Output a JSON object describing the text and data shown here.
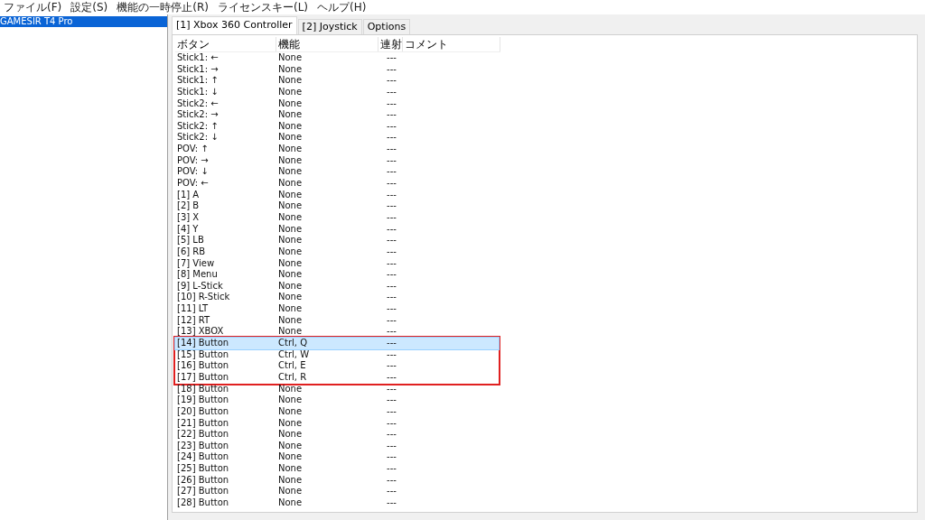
{
  "menu": [
    "ファイル(F)",
    "設定(S)",
    "機能の一時停止(R)",
    "ライセンスキー(L)",
    "ヘルプ(H)"
  ],
  "devices": [
    {
      "label": "GAMESIR T4 Pro",
      "selected": true
    }
  ],
  "tabs": [
    {
      "label": "[1] Xbox 360 Controller",
      "selected": true
    },
    {
      "label": "[2] Joystick",
      "selected": false
    },
    {
      "label": "Options",
      "selected": false
    }
  ],
  "table": {
    "columns": [
      "ボタン",
      "機能",
      "連射",
      "コメント"
    ],
    "rows": [
      {
        "button": "Stick1: ←",
        "function": "None",
        "rapid": "---",
        "selected": false,
        "highlighted": false
      },
      {
        "button": "Stick1: →",
        "function": "None",
        "rapid": "---",
        "selected": false,
        "highlighted": false
      },
      {
        "button": "Stick1: ↑",
        "function": "None",
        "rapid": "---",
        "selected": false,
        "highlighted": false
      },
      {
        "button": "Stick1: ↓",
        "function": "None",
        "rapid": "---",
        "selected": false,
        "highlighted": false
      },
      {
        "button": "Stick2: ←",
        "function": "None",
        "rapid": "---",
        "selected": false,
        "highlighted": false
      },
      {
        "button": "Stick2: →",
        "function": "None",
        "rapid": "---",
        "selected": false,
        "highlighted": false
      },
      {
        "button": "Stick2: ↑",
        "function": "None",
        "rapid": "---",
        "selected": false,
        "highlighted": false
      },
      {
        "button": "Stick2: ↓",
        "function": "None",
        "rapid": "---",
        "selected": false,
        "highlighted": false
      },
      {
        "button": "POV: ↑",
        "function": "None",
        "rapid": "---",
        "selected": false,
        "highlighted": false
      },
      {
        "button": "POV: →",
        "function": "None",
        "rapid": "---",
        "selected": false,
        "highlighted": false
      },
      {
        "button": "POV: ↓",
        "function": "None",
        "rapid": "---",
        "selected": false,
        "highlighted": false
      },
      {
        "button": "POV: ←",
        "function": "None",
        "rapid": "---",
        "selected": false,
        "highlighted": false
      },
      {
        "button": "[1] A",
        "function": "None",
        "rapid": "---",
        "selected": false,
        "highlighted": false
      },
      {
        "button": "[2] B",
        "function": "None",
        "rapid": "---",
        "selected": false,
        "highlighted": false
      },
      {
        "button": "[3] X",
        "function": "None",
        "rapid": "---",
        "selected": false,
        "highlighted": false
      },
      {
        "button": "[4] Y",
        "function": "None",
        "rapid": "---",
        "selected": false,
        "highlighted": false
      },
      {
        "button": "[5] LB",
        "function": "None",
        "rapid": "---",
        "selected": false,
        "highlighted": false
      },
      {
        "button": "[6] RB",
        "function": "None",
        "rapid": "---",
        "selected": false,
        "highlighted": false
      },
      {
        "button": "[7] View",
        "function": "None",
        "rapid": "---",
        "selected": false,
        "highlighted": false
      },
      {
        "button": "[8] Menu",
        "function": "None",
        "rapid": "---",
        "selected": false,
        "highlighted": false
      },
      {
        "button": "[9] L-Stick",
        "function": "None",
        "rapid": "---",
        "selected": false,
        "highlighted": false
      },
      {
        "button": "[10] R-Stick",
        "function": "None",
        "rapid": "---",
        "selected": false,
        "highlighted": false
      },
      {
        "button": "[11] LT",
        "function": "None",
        "rapid": "---",
        "selected": false,
        "highlighted": false
      },
      {
        "button": "[12] RT",
        "function": "None",
        "rapid": "---",
        "selected": false,
        "highlighted": false
      },
      {
        "button": "[13] XBOX",
        "function": "None",
        "rapid": "---",
        "selected": false,
        "highlighted": false
      },
      {
        "button": "[14] Button",
        "function": "Ctrl, Q",
        "rapid": "---",
        "selected": true,
        "highlighted": true
      },
      {
        "button": "[15] Button",
        "function": "Ctrl, W",
        "rapid": "---",
        "selected": false,
        "highlighted": true
      },
      {
        "button": "[16] Button",
        "function": "Ctrl, E",
        "rapid": "---",
        "selected": false,
        "highlighted": true
      },
      {
        "button": "[17] Button",
        "function": "Ctrl, R",
        "rapid": "---",
        "selected": false,
        "highlighted": true
      },
      {
        "button": "[18] Button",
        "function": "None",
        "rapid": "---",
        "selected": false,
        "highlighted": false
      },
      {
        "button": "[19] Button",
        "function": "None",
        "rapid": "---",
        "selected": false,
        "highlighted": false
      },
      {
        "button": "[20] Button",
        "function": "None",
        "rapid": "---",
        "selected": false,
        "highlighted": false
      },
      {
        "button": "[21] Button",
        "function": "None",
        "rapid": "---",
        "selected": false,
        "highlighted": false
      },
      {
        "button": "[22] Button",
        "function": "None",
        "rapid": "---",
        "selected": false,
        "highlighted": false
      },
      {
        "button": "[23] Button",
        "function": "None",
        "rapid": "---",
        "selected": false,
        "highlighted": false
      },
      {
        "button": "[24] Button",
        "function": "None",
        "rapid": "---",
        "selected": false,
        "highlighted": false
      },
      {
        "button": "[25] Button",
        "function": "None",
        "rapid": "---",
        "selected": false,
        "highlighted": false
      },
      {
        "button": "[26] Button",
        "function": "None",
        "rapid": "---",
        "selected": false,
        "highlighted": false
      },
      {
        "button": "[27] Button",
        "function": "None",
        "rapid": "---",
        "selected": false,
        "highlighted": false
      },
      {
        "button": "[28] Button",
        "function": "None",
        "rapid": "---",
        "selected": false,
        "highlighted": false
      }
    ]
  }
}
